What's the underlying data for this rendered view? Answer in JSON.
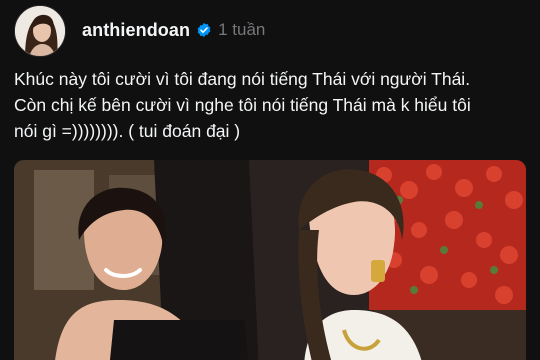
{
  "post": {
    "author": {
      "username": "anthiendoan",
      "verified": true,
      "avatar": "profile-photo"
    },
    "timestamp": "1 tuần",
    "caption_lines": [
      "Khúc này tôi cười vì tôi đang nói tiếng Thái với người Thái.",
      "Còn chị kế bên cười vì nghe tôi nói tiếng Thái mà k hiểu tôi",
      "nói gì =)))))))). ( tui đoán đại )"
    ],
    "media": {
      "type": "photo"
    }
  },
  "colors": {
    "background": "#101010",
    "text_primary": "#f3f5f7",
    "text_secondary": "#77777c",
    "verified_badge": "#0095f6"
  },
  "icons": {
    "verified": "verified-check-icon"
  }
}
